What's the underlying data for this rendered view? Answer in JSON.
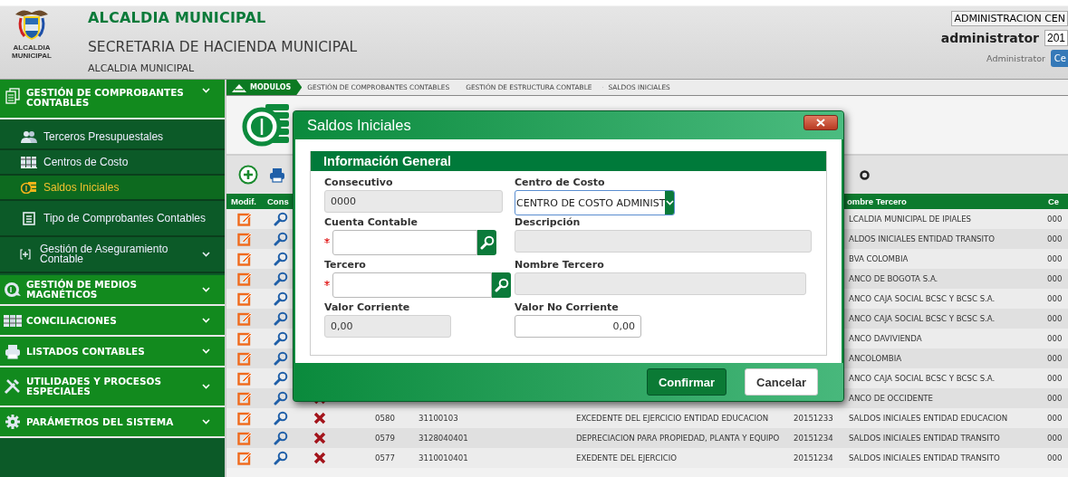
{
  "header": {
    "logo_caption": "ALCALDIA MUNICIPAL",
    "title": "ALCALDIA MUNICIPAL",
    "subtitle": "SECRETARIA DE HACIENDA MUNICIPAL",
    "entity": "ALCALDIA MUNICIPAL",
    "unit_select": "ADMINISTRACION CEN",
    "user": "administrator",
    "year_field": "201",
    "role": "Administrator",
    "user_button": "Ce"
  },
  "sidebar": {
    "groups": [
      {
        "label": "GESTIÓN DE COMPROBANTES CONTABLES",
        "children": [
          {
            "label": "Terceros Presupuestales",
            "selected": false,
            "expandable": false
          },
          {
            "label": "Centros de Costo",
            "selected": false,
            "expandable": false
          },
          {
            "label": "Saldos Iniciales",
            "selected": true,
            "expandable": false
          },
          {
            "label": "Tipo de Comprobantes Contables",
            "selected": false,
            "expandable": false
          },
          {
            "label": "Gestión de Aseguramiento Contable",
            "selected": false,
            "expandable": true
          }
        ]
      },
      {
        "label": "GESTIÓN DE MEDIOS MAGNÉTICOS"
      },
      {
        "label": "CONCILIACIONES"
      },
      {
        "label": "LISTADOS CONTABLES"
      },
      {
        "label": "UTILIDADES Y PROCESOS ESPECIALES"
      },
      {
        "label": "PARÁMETROS DEL SISTEMA"
      }
    ]
  },
  "breadcrumb": [
    "MODULOS",
    "GESTIÓN DE COMPROBANTES CONTABLES",
    "GESTIÓN DE ESTRUCTURA CONTABLE",
    "SALDOS INICIALES"
  ],
  "table": {
    "columns": [
      "Modif.",
      "Cons",
      "ombre Tercero",
      "Ce"
    ],
    "rows": [
      {
        "nombre_tercero": "LCALDIA MUNICIPAL DE IPIALES",
        "column_4": "000"
      },
      {
        "nombre_tercero": "ALDOS INICIALES ENTIDAD TRANSITO",
        "column_4": "000"
      },
      {
        "nombre_tercero": "BVA COLOMBIA",
        "column_4": "000"
      },
      {
        "nombre_tercero": "ANCO DE BOGOTA S.A.",
        "column_4": "000"
      },
      {
        "nombre_tercero": "ANCO CAJA SOCIAL BCSC Y BCSC S.A.",
        "column_4": "000"
      },
      {
        "nombre_tercero": "ANCO CAJA SOCIAL BCSC Y BCSC S.A.",
        "column_4": "000"
      },
      {
        "nombre_tercero": "ANCO DAVIVIENDA",
        "column_4": "000"
      },
      {
        "nombre_tercero": "ANCOLOMBIA",
        "column_4": "000"
      },
      {
        "nombre_tercero": "ANCO CAJA SOCIAL BCSC Y BCSC S.A.",
        "column_4": "000"
      },
      {
        "nombre_tercero": "ANCO DE OCCIDENTE",
        "column_4": "000"
      },
      {
        "consecutivo": "0580",
        "cuenta": "31100103",
        "descripcion": "EXCEDENTE DEL EJERCICIO ENTIDAD EDUCACION",
        "tercero": "20151233",
        "nombre_tercero": "SALDOS INICIALES ENTIDAD EDUCACION",
        "column_4": "000"
      },
      {
        "consecutivo": "0579",
        "cuenta": "3128040401",
        "descripcion": "DEPRECIACION PARA PROPIEDAD, PLANTA Y EQUIPO",
        "tercero": "20151234",
        "nombre_tercero": "SALDOS INICIALES ENTIDAD TRANSITO",
        "column_4": "000"
      },
      {
        "consecutivo": "0577",
        "cuenta": "3110010401",
        "descripcion": "EXEDENTE DEL EJERCICIO",
        "tercero": "20151234",
        "nombre_tercero": "SALDOS INICIALES ENTIDAD TRANSITO",
        "column_4": "000"
      }
    ]
  },
  "dialog": {
    "title": "Saldos Iniciales",
    "section": "Información General",
    "fields": [
      {
        "label": "Consecutivo",
        "kind": "text",
        "value": "0000",
        "required": false,
        "disabled": true
      },
      {
        "label": "Centro de Costo",
        "kind": "select",
        "value": "CENTRO DE COSTO ADMINIST",
        "required": false,
        "disabled": false
      },
      {
        "label": "Cuenta Contable",
        "kind": "lookup",
        "required": true,
        "disabled": false
      },
      {
        "label": "Descripción",
        "kind": "text",
        "required": false,
        "disabled": true
      },
      {
        "label": "Tercero",
        "kind": "lookup",
        "required": true,
        "disabled": false
      },
      {
        "label": "Nombre Tercero",
        "kind": "text",
        "required": false,
        "disabled": true
      },
      {
        "label": "Valor Corriente",
        "kind": "text",
        "value": "0,00",
        "required": false,
        "disabled": true
      },
      {
        "label": "Valor No Corriente",
        "kind": "amount",
        "value": "0,00",
        "required": false,
        "disabled": false
      }
    ],
    "buttons": [
      "Confirmar",
      "Cancelar"
    ]
  }
}
